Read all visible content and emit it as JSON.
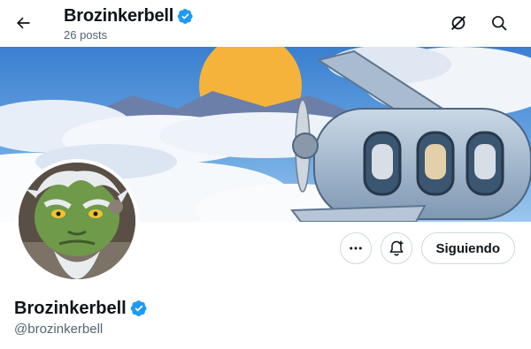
{
  "header": {
    "title": "Brozinkerbell",
    "posts_count": "26 posts"
  },
  "profile": {
    "display_name": "Brozinkerbell",
    "handle": "@brozinkerbell",
    "verified": true,
    "follow_button_label": "Siguiendo"
  },
  "icons": {
    "back": "arrow-left-icon",
    "grok": "grok-icon",
    "search": "search-icon",
    "more": "more-icon",
    "notify": "bell-plus-icon",
    "verified": "verified-badge-icon"
  },
  "colors": {
    "verified": "#1d9bf0",
    "text_primary": "#0f1419",
    "text_secondary": "#536471",
    "border": "#cfd9de"
  }
}
